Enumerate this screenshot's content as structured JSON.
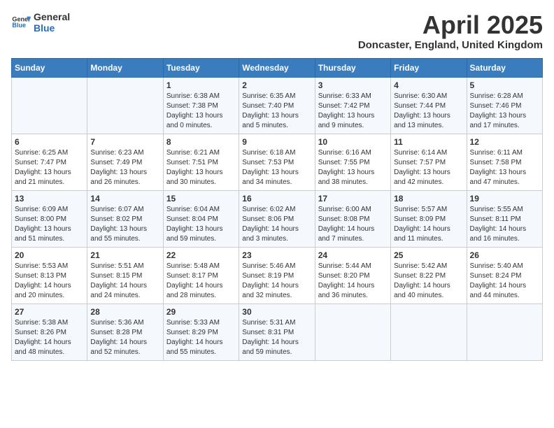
{
  "header": {
    "logo_general": "General",
    "logo_blue": "Blue",
    "main_title": "April 2025",
    "subtitle": "Doncaster, England, United Kingdom"
  },
  "weekdays": [
    "Sunday",
    "Monday",
    "Tuesday",
    "Wednesday",
    "Thursday",
    "Friday",
    "Saturday"
  ],
  "weeks": [
    [
      {
        "day": "",
        "info": ""
      },
      {
        "day": "",
        "info": ""
      },
      {
        "day": "1",
        "info": "Sunrise: 6:38 AM\nSunset: 7:38 PM\nDaylight: 13 hours and 0 minutes."
      },
      {
        "day": "2",
        "info": "Sunrise: 6:35 AM\nSunset: 7:40 PM\nDaylight: 13 hours and 5 minutes."
      },
      {
        "day": "3",
        "info": "Sunrise: 6:33 AM\nSunset: 7:42 PM\nDaylight: 13 hours and 9 minutes."
      },
      {
        "day": "4",
        "info": "Sunrise: 6:30 AM\nSunset: 7:44 PM\nDaylight: 13 hours and 13 minutes."
      },
      {
        "day": "5",
        "info": "Sunrise: 6:28 AM\nSunset: 7:46 PM\nDaylight: 13 hours and 17 minutes."
      }
    ],
    [
      {
        "day": "6",
        "info": "Sunrise: 6:25 AM\nSunset: 7:47 PM\nDaylight: 13 hours and 21 minutes."
      },
      {
        "day": "7",
        "info": "Sunrise: 6:23 AM\nSunset: 7:49 PM\nDaylight: 13 hours and 26 minutes."
      },
      {
        "day": "8",
        "info": "Sunrise: 6:21 AM\nSunset: 7:51 PM\nDaylight: 13 hours and 30 minutes."
      },
      {
        "day": "9",
        "info": "Sunrise: 6:18 AM\nSunset: 7:53 PM\nDaylight: 13 hours and 34 minutes."
      },
      {
        "day": "10",
        "info": "Sunrise: 6:16 AM\nSunset: 7:55 PM\nDaylight: 13 hours and 38 minutes."
      },
      {
        "day": "11",
        "info": "Sunrise: 6:14 AM\nSunset: 7:57 PM\nDaylight: 13 hours and 42 minutes."
      },
      {
        "day": "12",
        "info": "Sunrise: 6:11 AM\nSunset: 7:58 PM\nDaylight: 13 hours and 47 minutes."
      }
    ],
    [
      {
        "day": "13",
        "info": "Sunrise: 6:09 AM\nSunset: 8:00 PM\nDaylight: 13 hours and 51 minutes."
      },
      {
        "day": "14",
        "info": "Sunrise: 6:07 AM\nSunset: 8:02 PM\nDaylight: 13 hours and 55 minutes."
      },
      {
        "day": "15",
        "info": "Sunrise: 6:04 AM\nSunset: 8:04 PM\nDaylight: 13 hours and 59 minutes."
      },
      {
        "day": "16",
        "info": "Sunrise: 6:02 AM\nSunset: 8:06 PM\nDaylight: 14 hours and 3 minutes."
      },
      {
        "day": "17",
        "info": "Sunrise: 6:00 AM\nSunset: 8:08 PM\nDaylight: 14 hours and 7 minutes."
      },
      {
        "day": "18",
        "info": "Sunrise: 5:57 AM\nSunset: 8:09 PM\nDaylight: 14 hours and 11 minutes."
      },
      {
        "day": "19",
        "info": "Sunrise: 5:55 AM\nSunset: 8:11 PM\nDaylight: 14 hours and 16 minutes."
      }
    ],
    [
      {
        "day": "20",
        "info": "Sunrise: 5:53 AM\nSunset: 8:13 PM\nDaylight: 14 hours and 20 minutes."
      },
      {
        "day": "21",
        "info": "Sunrise: 5:51 AM\nSunset: 8:15 PM\nDaylight: 14 hours and 24 minutes."
      },
      {
        "day": "22",
        "info": "Sunrise: 5:48 AM\nSunset: 8:17 PM\nDaylight: 14 hours and 28 minutes."
      },
      {
        "day": "23",
        "info": "Sunrise: 5:46 AM\nSunset: 8:19 PM\nDaylight: 14 hours and 32 minutes."
      },
      {
        "day": "24",
        "info": "Sunrise: 5:44 AM\nSunset: 8:20 PM\nDaylight: 14 hours and 36 minutes."
      },
      {
        "day": "25",
        "info": "Sunrise: 5:42 AM\nSunset: 8:22 PM\nDaylight: 14 hours and 40 minutes."
      },
      {
        "day": "26",
        "info": "Sunrise: 5:40 AM\nSunset: 8:24 PM\nDaylight: 14 hours and 44 minutes."
      }
    ],
    [
      {
        "day": "27",
        "info": "Sunrise: 5:38 AM\nSunset: 8:26 PM\nDaylight: 14 hours and 48 minutes."
      },
      {
        "day": "28",
        "info": "Sunrise: 5:36 AM\nSunset: 8:28 PM\nDaylight: 14 hours and 52 minutes."
      },
      {
        "day": "29",
        "info": "Sunrise: 5:33 AM\nSunset: 8:29 PM\nDaylight: 14 hours and 55 minutes."
      },
      {
        "day": "30",
        "info": "Sunrise: 5:31 AM\nSunset: 8:31 PM\nDaylight: 14 hours and 59 minutes."
      },
      {
        "day": "",
        "info": ""
      },
      {
        "day": "",
        "info": ""
      },
      {
        "day": "",
        "info": ""
      }
    ]
  ]
}
